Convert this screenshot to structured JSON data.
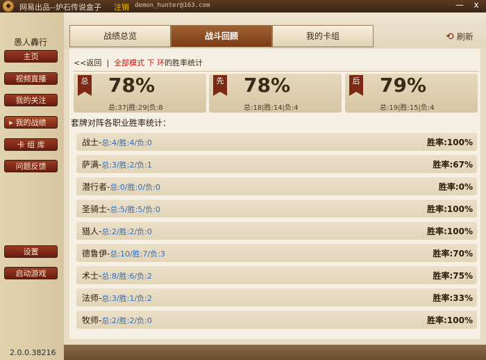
{
  "titlebar": {
    "title": "网易出品--炉石传说盒子",
    "register": "注销",
    "email": "demon_hunter@163.com",
    "minimize": "—",
    "close": "x"
  },
  "sidebar": {
    "username": "愚人轟行",
    "items": [
      {
        "label": "主页"
      },
      {
        "label": "视频直播"
      },
      {
        "label": "我的关注"
      },
      {
        "label": "我的战绩"
      },
      {
        "label": "卡 组 库"
      },
      {
        "label": "问题反馈"
      }
    ],
    "settings": "设置",
    "launch": "启动游戏",
    "version": "2.0.0.38216"
  },
  "tabs": [
    {
      "label": "战绩总览"
    },
    {
      "label": "战斗回顾"
    },
    {
      "label": "我的卡组"
    }
  ],
  "refresh_label": "刷新",
  "breadcrumb": {
    "back": "<<返回",
    "sep": "|",
    "mode": "全部模式",
    "under": "下",
    "ring": "环",
    "suffix": "的胜率统计"
  },
  "cards": [
    {
      "flag": "总",
      "pct": "78%",
      "detail": "总:37|胜:29|负:8"
    },
    {
      "flag": "先",
      "pct": "78%",
      "detail": "总:18|胜:14|负:4"
    },
    {
      "flag": "后",
      "pct": "79%",
      "detail": "总:19|胜:15|负:4"
    }
  ],
  "section_title": "套牌对阵各职业胜率统计：",
  "rows": [
    {
      "cls": "战士-",
      "stats": "总:4/胜:4/负:0",
      "rate": "胜率:100%"
    },
    {
      "cls": "萨满-",
      "stats": "总:3/胜:2/负:1",
      "rate": "胜率:67%"
    },
    {
      "cls": "潜行者-",
      "stats": "总:0/胜:0/负:0",
      "rate": "胜率:0%"
    },
    {
      "cls": "圣骑士-",
      "stats": "总:5/胜:5/负:0",
      "rate": "胜率:100%"
    },
    {
      "cls": "猎人-",
      "stats": "总:2/胜:2/负:0",
      "rate": "胜率:100%"
    },
    {
      "cls": "德鲁伊-",
      "stats": "总:10/胜:7/负:3",
      "rate": "胜率:70%"
    },
    {
      "cls": "术士-",
      "stats": "总:8/胜:6/负:2",
      "rate": "胜率:75%"
    },
    {
      "cls": "法师-",
      "stats": "总:3/胜:1/负:2",
      "rate": "胜率:33%"
    },
    {
      "cls": "牧师-",
      "stats": "总:2/胜:2/负:0",
      "rate": "胜率:100%"
    }
  ]
}
